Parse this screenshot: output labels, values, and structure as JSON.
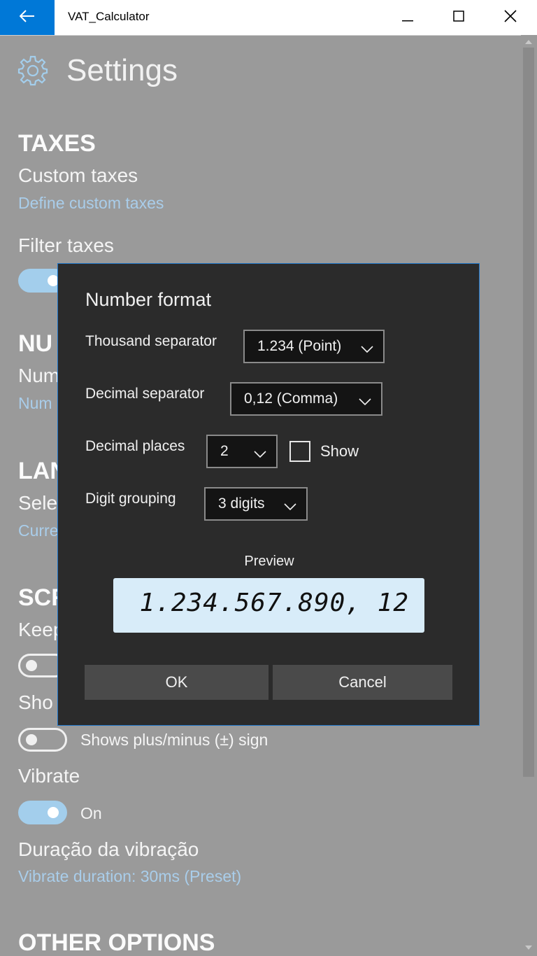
{
  "window": {
    "title": "VAT_Calculator",
    "accent_color": "#0078d7"
  },
  "page": {
    "title": "Settings",
    "icon": "gear-icon"
  },
  "sections": {
    "taxes": {
      "header": "TAXES",
      "custom_taxes_title": "Custom taxes",
      "custom_taxes_link": "Define custom taxes",
      "filter_taxes_title": "Filter taxes"
    },
    "number": {
      "header_visible": "NU",
      "title_visible": "Num",
      "link_visible": "Num"
    },
    "language": {
      "header_visible": "LAN",
      "title_visible": "Sele",
      "link_visible": "Curre"
    },
    "screen": {
      "header_visible": "SCR",
      "keep_title_visible": "Keep",
      "show_title_visible": "Sho",
      "plus_minus_label": "Shows plus/minus (±) sign",
      "vibrate_title": "Vibrate",
      "vibrate_state": "On",
      "duration_title": "Duração da vibração",
      "duration_link": "Vibrate duration: 30ms (Preset)"
    },
    "other": {
      "header": "OTHER OPTIONS"
    }
  },
  "dialog": {
    "title": "Number format",
    "thousand_separator": {
      "label": "Thousand separator",
      "value": "1.234 (Point)"
    },
    "decimal_separator": {
      "label": "Decimal separator",
      "value": "0,12 (Comma)"
    },
    "decimal_places": {
      "label": "Decimal places",
      "value": "2",
      "show_label": "Show",
      "show_checked": false
    },
    "digit_grouping": {
      "label": "Digit grouping",
      "value": "3 digits"
    },
    "preview": {
      "label": "Preview",
      "value": "1.234.567.890, 12"
    },
    "ok_label": "OK",
    "cancel_label": "Cancel"
  }
}
